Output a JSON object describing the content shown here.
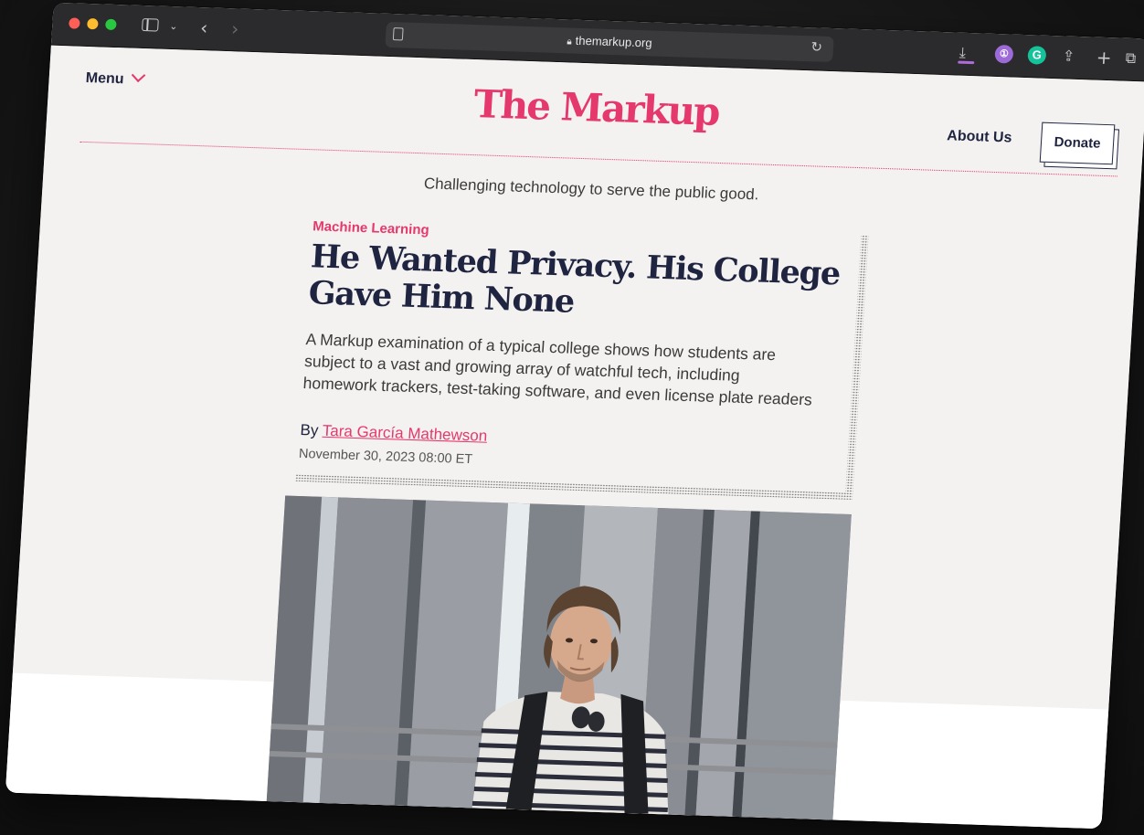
{
  "browser": {
    "url": "themarkup.org"
  },
  "site": {
    "menu_label": "Menu",
    "logo_text": "The Markup",
    "about_label": "About Us",
    "donate_label": "Donate",
    "tagline": "Challenging technology to serve the public good."
  },
  "article": {
    "category": "Machine Learning",
    "headline": "He Wanted Privacy. His College Gave Him None",
    "dek": "A Markup examination of a typical college shows how students are subject to a vast and growing array of watchful tech, including homework trackers, test-taking software, and even license plate readers",
    "byline_prefix": "By",
    "author": "Tara García Mathewson",
    "date": "November 30, 2023 08:00 ET"
  },
  "colors": {
    "brand_pink": "#e5386d",
    "navy": "#1f2440",
    "page_bg": "#f4f2f0"
  },
  "icons": {
    "toolbar": [
      "sidebar-icon",
      "chevron-down-icon",
      "back-icon",
      "forward-icon",
      "reader-icon",
      "lock-icon",
      "reload-icon",
      "download-icon",
      "1password-icon",
      "grammarly-icon",
      "share-icon",
      "new-tab-icon",
      "tabs-overview-icon"
    ]
  }
}
